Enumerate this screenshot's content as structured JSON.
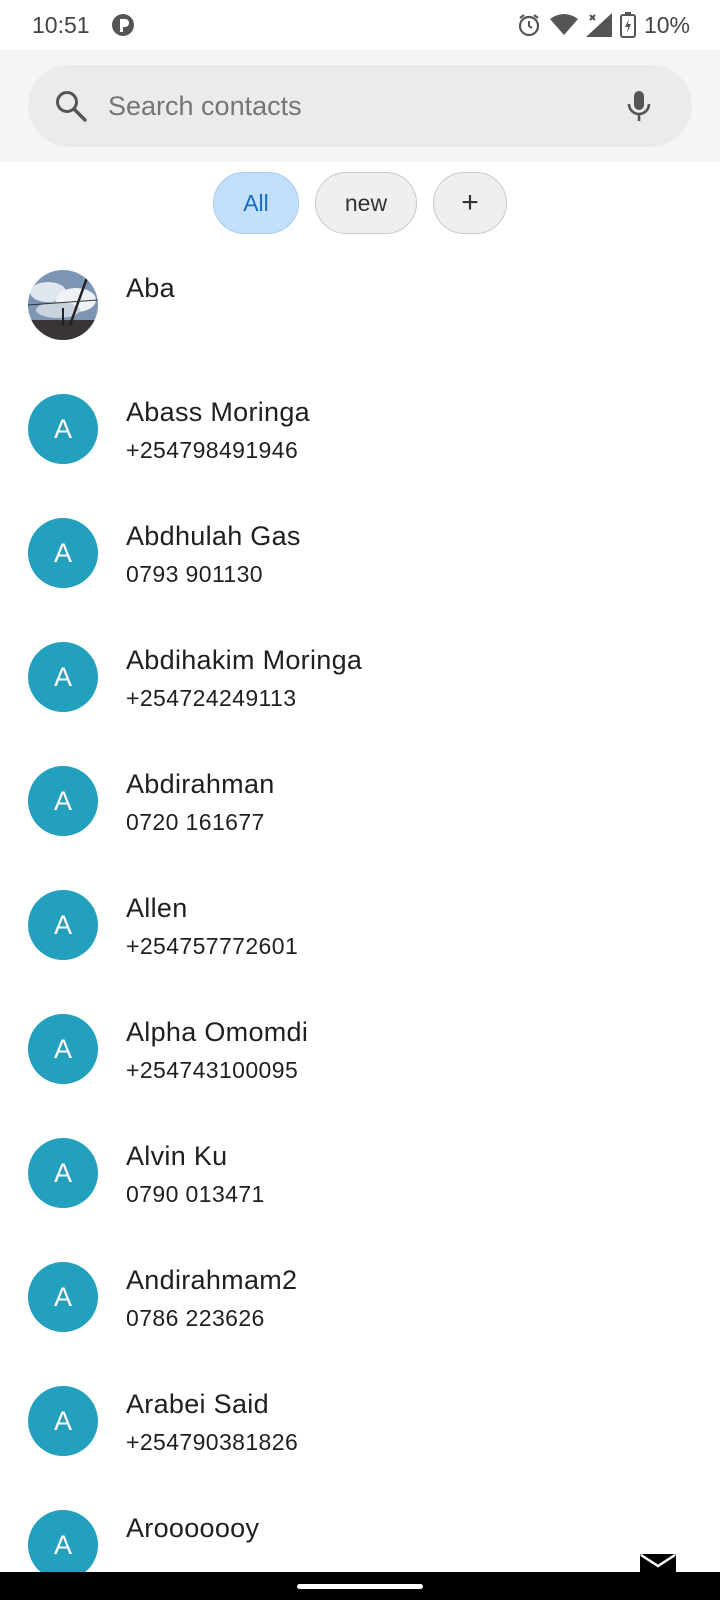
{
  "status_bar": {
    "time": "10:51",
    "battery_text": "10%",
    "icons": [
      "app-notification-icon",
      "alarm-icon",
      "wifi-icon",
      "signal-icon",
      "battery-icon"
    ]
  },
  "search": {
    "placeholder": "Search contacts",
    "value": ""
  },
  "chips": {
    "all": "All",
    "new": "new",
    "add": "+"
  },
  "contacts": [
    {
      "name": "Aba",
      "phone": "",
      "avatar": "photo"
    },
    {
      "name": "Abass Moringa",
      "phone": "+254798491946",
      "avatar": "A"
    },
    {
      "name": "Abdhulah Gas",
      "phone": "0793 901130",
      "avatar": "A"
    },
    {
      "name": "Abdihakim Moringa",
      "phone": "+254724249113",
      "avatar": "A"
    },
    {
      "name": "Abdirahman",
      "phone": "0720 161677",
      "avatar": "A"
    },
    {
      "name": "Allen",
      "phone": "+254757772601",
      "avatar": "A"
    },
    {
      "name": "Alpha Omomdi",
      "phone": "+254743100095",
      "avatar": "A"
    },
    {
      "name": "Alvin Ku",
      "phone": "0790 013471",
      "avatar": "A"
    },
    {
      "name": "Andirahmam2",
      "phone": "0786 223626",
      "avatar": "A"
    },
    {
      "name": "Arabei Said",
      "phone": "+254790381826",
      "avatar": "A"
    },
    {
      "name": "Arooooooy",
      "phone": "",
      "avatar": "A"
    }
  ],
  "colors": {
    "avatar_bg": "#22a0bd",
    "chip_selected_bg": "#c2e0fb",
    "chip_selected_text": "#1a6bbf"
  }
}
